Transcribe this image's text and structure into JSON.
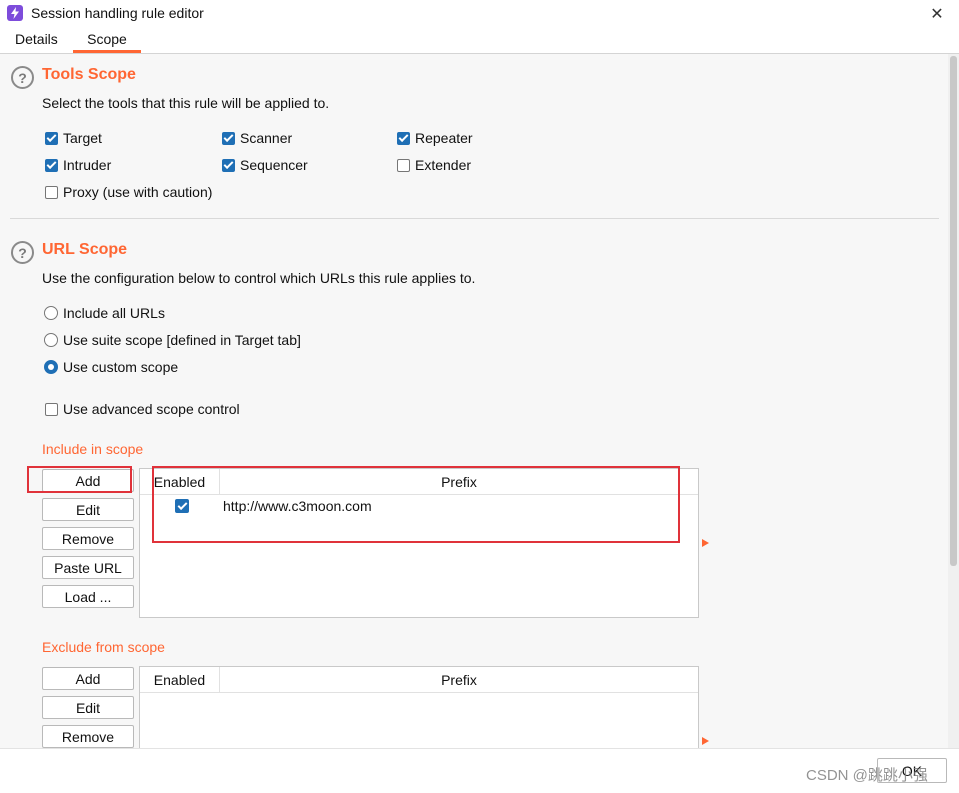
{
  "window": {
    "title": "Session handling rule editor",
    "close_symbol": "✕",
    "app_icon": "lightning-bolt-icon"
  },
  "tabs": [
    {
      "label": "Details",
      "active": false
    },
    {
      "label": "Scope",
      "active": true
    }
  ],
  "colors": {
    "accent": "#ff6633",
    "checkbox_blue": "#1f6fb5",
    "highlight_red": "#e0323a",
    "app_icon_purple": "#7d4cdb"
  },
  "tools_scope": {
    "help_symbol": "?",
    "title": "Tools Scope",
    "description": "Select the tools that this rule will be applied to.",
    "tools": [
      {
        "label": "Target",
        "checked": true
      },
      {
        "label": "Scanner",
        "checked": true
      },
      {
        "label": "Repeater",
        "checked": true
      },
      {
        "label": "Intruder",
        "checked": true
      },
      {
        "label": "Sequencer",
        "checked": true
      },
      {
        "label": "Extender",
        "checked": false
      },
      {
        "label": "Proxy (use with caution)",
        "checked": false
      }
    ]
  },
  "url_scope": {
    "help_symbol": "?",
    "title": "URL Scope",
    "description": "Use the configuration below to control which URLs this rule applies to.",
    "options": [
      {
        "label": "Include all URLs",
        "selected": false
      },
      {
        "label": "Use suite scope [defined in Target tab]",
        "selected": false
      },
      {
        "label": "Use custom scope",
        "selected": true
      }
    ],
    "advanced": {
      "label": "Use advanced scope control",
      "checked": false
    }
  },
  "include": {
    "title": "Include in scope",
    "buttons": [
      "Add",
      "Edit",
      "Remove",
      "Paste URL",
      "Load ..."
    ],
    "columns": [
      "Enabled",
      "Prefix"
    ],
    "rows": [
      {
        "enabled": true,
        "prefix": "http://www.c3moon.com"
      }
    ]
  },
  "exclude": {
    "title": "Exclude from scope",
    "buttons": [
      "Add",
      "Edit",
      "Remove"
    ],
    "columns": [
      "Enabled",
      "Prefix"
    ],
    "rows": []
  },
  "footer": {
    "ok_label": "OK",
    "watermark": "CSDN @跳跳小强"
  }
}
